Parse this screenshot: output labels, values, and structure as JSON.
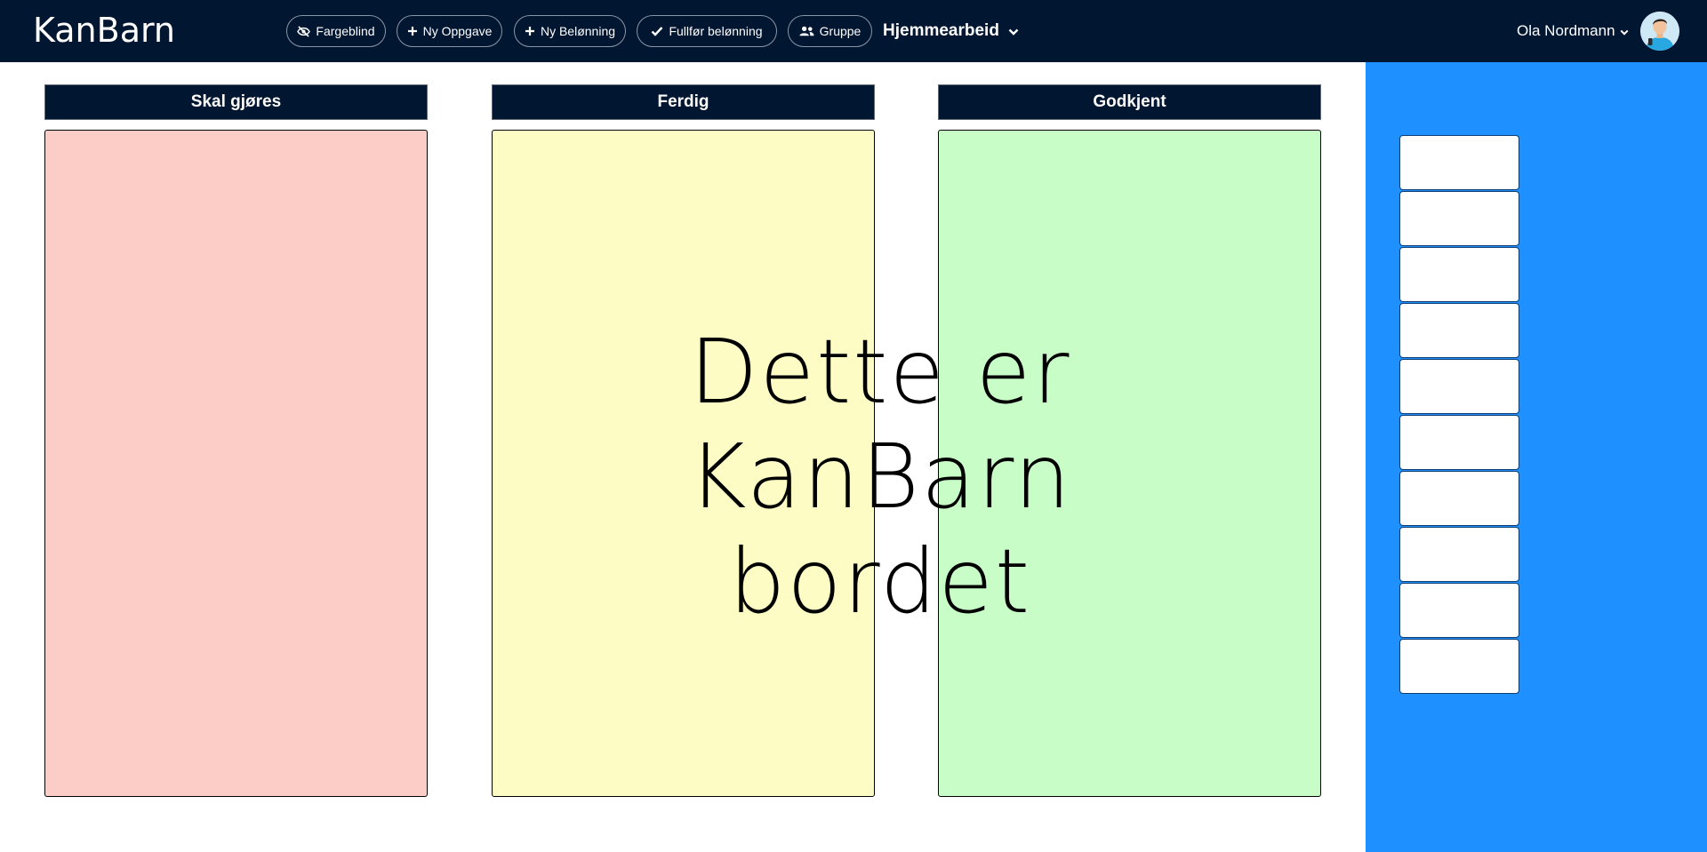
{
  "navbar": {
    "brand": "KanBarn",
    "buttons": [
      {
        "label": "Fargeblind",
        "icon": "eye-slash-icon"
      },
      {
        "label": "Ny Oppgave",
        "icon": "plus-icon"
      },
      {
        "label": "Ny Belønning",
        "icon": "plus-icon"
      },
      {
        "label": "Fullfør belønning",
        "icon": "check-icon"
      },
      {
        "label": "Gruppe",
        "icon": "users-icon"
      }
    ],
    "group_selector": {
      "label": "Hjemmearbeid",
      "icon": "chevron-down-icon"
    },
    "user_menu": {
      "label": "Ola Nordmann",
      "icon": "chevron-down-icon"
    }
  },
  "board": {
    "columns": [
      {
        "title": "Skal gjøres",
        "color": "#fccdc7"
      },
      {
        "title": "Ferdig",
        "color": "#fdfcc4"
      },
      {
        "title": "Godkjent",
        "color": "#c8fdc8"
      }
    ]
  },
  "sidebar": {
    "color": "#1e90ff",
    "slot_count": 10
  },
  "overlay": {
    "line1": "Dette er",
    "line2": "KanBarn bordet"
  },
  "colors": {
    "navbar": "#011631",
    "accent": "#1e90ff"
  }
}
